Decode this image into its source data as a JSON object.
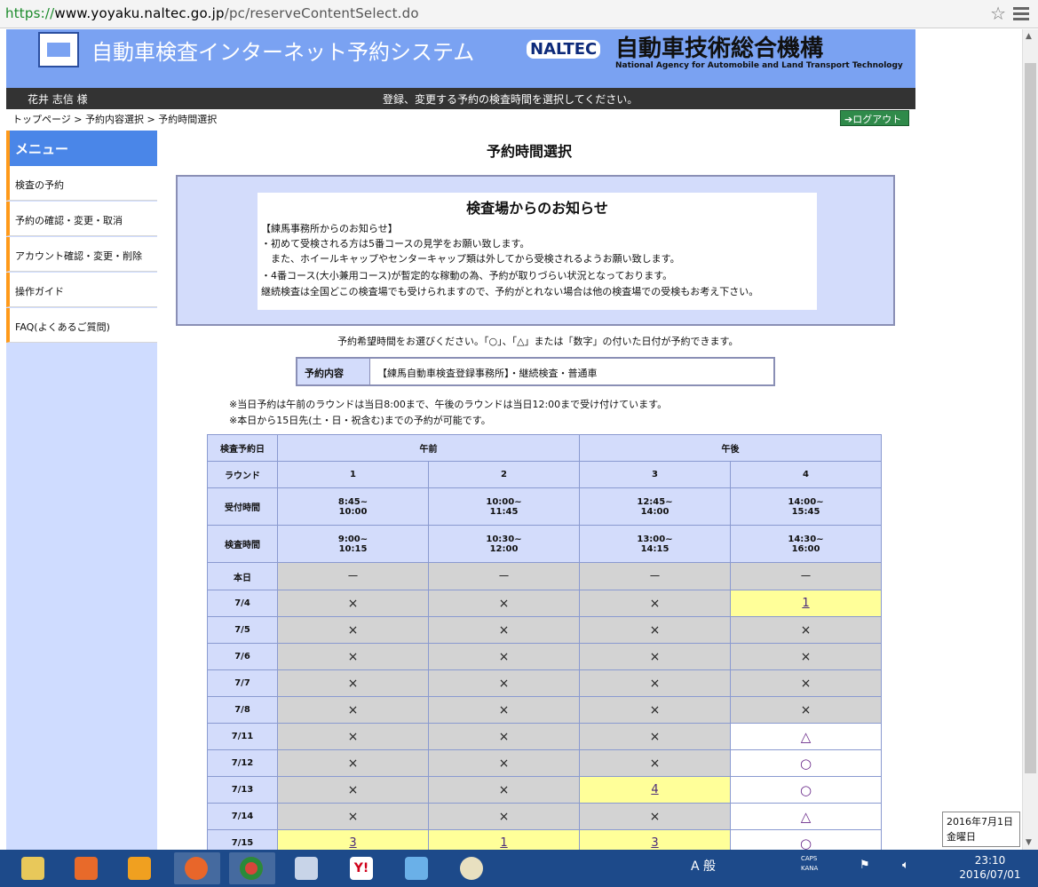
{
  "browser": {
    "url_scheme": "https://",
    "url_host": "www.yoyaku.naltec.go.jp",
    "url_path": "/pc/reserveContentSelect.do"
  },
  "header": {
    "site_title": "自動車検査インターネット予約システム",
    "naltec": "NALTEC",
    "org_name": "自動車技術総合機構",
    "org_en": "National Agency for Automobile and Land Transport Technology",
    "username": "花井 志信 様",
    "instruction": "登録、変更する予約の検査時間を選択してください。"
  },
  "breadcrumb": "トップページ > 予約内容選択 > 予約時間選択",
  "logout_label": "ログアウト",
  "sidebar": {
    "title": "メニュー",
    "items": [
      {
        "label": "検査の予約"
      },
      {
        "label": "予約の確認・変更・取消"
      },
      {
        "label": "アカウント確認・変更・削除"
      },
      {
        "label": "操作ガイド"
      },
      {
        "label": "FAQ(よくあるご質問)"
      }
    ]
  },
  "main": {
    "heading": "予約時間選択",
    "notice_title": "検査場からのお知らせ",
    "notice_lines": [
      "【練馬事務所からのお知らせ】",
      "・初めて受検される方は5番コースの見学をお願い致します。",
      "　また、ホイールキャップやセンターキャップ類は外してから受検されるようお願い致します。",
      "・4番コース(大小兼用コース)が暫定的な稼動の為、予約が取りづらい状況となっております。",
      "継続検査は全国どこの検査場でも受けられますので、予約がとれない場合は他の検査場での受検もお考え下さい。"
    ],
    "select_hint": "予約希望時間をお選びください。「○」、「△」または「数字」の付いた日付が予約できます。",
    "content_label": "予約内容",
    "content_value": "【練馬自動車検査登録事務所】・継続検査・普通車",
    "note1": "※当日予約は午前のラウンドは当日8:00まで、午後のラウンドは当日12:00まで受け付けています。",
    "note2": "※本日から15日先(土・日・祝含む)までの予約が可能です。"
  },
  "table": {
    "col_date": "検査予約日",
    "am": "午前",
    "pm": "午後",
    "round_label": "ラウンド",
    "rounds": [
      "1",
      "2",
      "3",
      "4"
    ],
    "reception_label": "受付時間",
    "reception": [
      [
        "8:45~",
        "10:00"
      ],
      [
        "10:00~",
        "11:45"
      ],
      [
        "12:45~",
        "14:00"
      ],
      [
        "14:00~",
        "15:45"
      ]
    ],
    "inspection_label": "検査時間",
    "inspection": [
      [
        "9:00~",
        "10:15"
      ],
      [
        "10:30~",
        "12:00"
      ],
      [
        "13:00~",
        "14:15"
      ],
      [
        "14:30~",
        "16:00"
      ]
    ],
    "rows": [
      {
        "date": "本日",
        "cells": [
          {
            "t": "－",
            "c": "gray",
            "k": "mark"
          },
          {
            "t": "－",
            "c": "gray",
            "k": "mark"
          },
          {
            "t": "－",
            "c": "gray",
            "k": "mark"
          },
          {
            "t": "－",
            "c": "gray",
            "k": "mark"
          }
        ]
      },
      {
        "date": "7/4",
        "cells": [
          {
            "t": "×",
            "c": "gray",
            "k": "mark"
          },
          {
            "t": "×",
            "c": "gray",
            "k": "mark"
          },
          {
            "t": "×",
            "c": "gray",
            "k": "mark"
          },
          {
            "t": "1",
            "c": "yellow",
            "k": "link"
          }
        ]
      },
      {
        "date": "7/5",
        "cells": [
          {
            "t": "×",
            "c": "gray",
            "k": "mark"
          },
          {
            "t": "×",
            "c": "gray",
            "k": "mark"
          },
          {
            "t": "×",
            "c": "gray",
            "k": "mark"
          },
          {
            "t": "×",
            "c": "gray",
            "k": "mark"
          }
        ]
      },
      {
        "date": "7/6",
        "cells": [
          {
            "t": "×",
            "c": "gray",
            "k": "mark"
          },
          {
            "t": "×",
            "c": "gray",
            "k": "mark"
          },
          {
            "t": "×",
            "c": "gray",
            "k": "mark"
          },
          {
            "t": "×",
            "c": "gray",
            "k": "mark"
          }
        ]
      },
      {
        "date": "7/7",
        "cells": [
          {
            "t": "×",
            "c": "gray",
            "k": "mark"
          },
          {
            "t": "×",
            "c": "gray",
            "k": "mark"
          },
          {
            "t": "×",
            "c": "gray",
            "k": "mark"
          },
          {
            "t": "×",
            "c": "gray",
            "k": "mark"
          }
        ]
      },
      {
        "date": "7/8",
        "cells": [
          {
            "t": "×",
            "c": "gray",
            "k": "mark"
          },
          {
            "t": "×",
            "c": "gray",
            "k": "mark"
          },
          {
            "t": "×",
            "c": "gray",
            "k": "mark"
          },
          {
            "t": "×",
            "c": "gray",
            "k": "mark"
          }
        ]
      },
      {
        "date": "7/11",
        "cells": [
          {
            "t": "×",
            "c": "gray",
            "k": "mark"
          },
          {
            "t": "×",
            "c": "gray",
            "k": "mark"
          },
          {
            "t": "×",
            "c": "gray",
            "k": "mark"
          },
          {
            "t": "△",
            "c": "white",
            "k": "sym"
          }
        ]
      },
      {
        "date": "7/12",
        "cells": [
          {
            "t": "×",
            "c": "gray",
            "k": "mark"
          },
          {
            "t": "×",
            "c": "gray",
            "k": "mark"
          },
          {
            "t": "×",
            "c": "gray",
            "k": "mark"
          },
          {
            "t": "○",
            "c": "white",
            "k": "sym"
          }
        ]
      },
      {
        "date": "7/13",
        "cells": [
          {
            "t": "×",
            "c": "gray",
            "k": "mark"
          },
          {
            "t": "×",
            "c": "gray",
            "k": "mark"
          },
          {
            "t": "4",
            "c": "yellow",
            "k": "link"
          },
          {
            "t": "○",
            "c": "white",
            "k": "sym"
          }
        ]
      },
      {
        "date": "7/14",
        "cells": [
          {
            "t": "×",
            "c": "gray",
            "k": "mark"
          },
          {
            "t": "×",
            "c": "gray",
            "k": "mark"
          },
          {
            "t": "×",
            "c": "gray",
            "k": "mark"
          },
          {
            "t": "△",
            "c": "white",
            "k": "sym"
          }
        ]
      },
      {
        "date": "7/15",
        "cells": [
          {
            "t": "3",
            "c": "yellow",
            "k": "link"
          },
          {
            "t": "1",
            "c": "yellow",
            "k": "link"
          },
          {
            "t": "3",
            "c": "yellow",
            "k": "link"
          },
          {
            "t": "○",
            "c": "white",
            "k": "sym"
          }
        ]
      }
    ]
  },
  "taskbar": {
    "ime_label": "A 般",
    "caps": "CAPS",
    "kana": "KANA",
    "time": "23:10",
    "date": "2016/07/01",
    "tooltip_date": "2016年7月1日",
    "tooltip_day": "金曜日"
  }
}
